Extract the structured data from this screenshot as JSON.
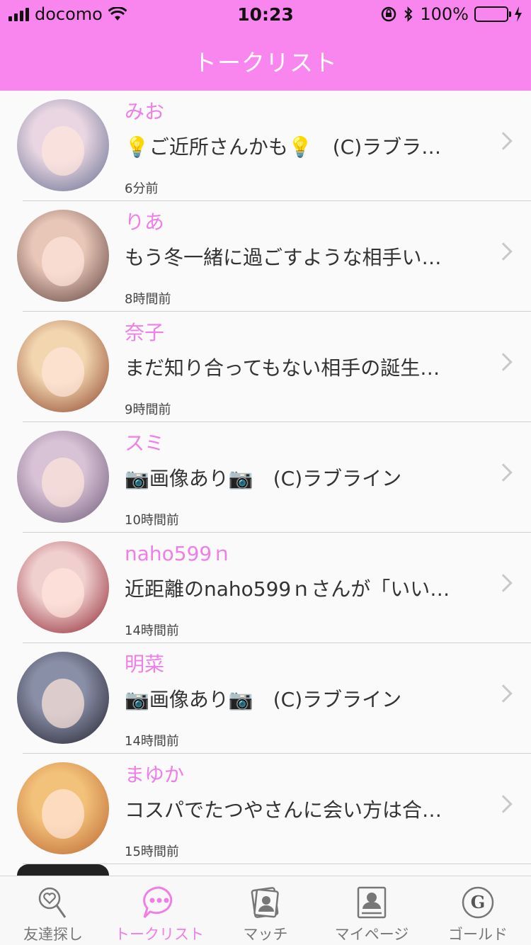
{
  "status_bar": {
    "carrier": "docomo",
    "time": "10:23",
    "battery": "100%"
  },
  "header": {
    "title": "トークリスト"
  },
  "talks": [
    {
      "name": "みお",
      "message": "💡ご近所さんかも💡　(C)ラブラ…",
      "time_ago": "6分前",
      "avatar_colors": [
        "#e9d6e2",
        "#5f6a8c"
      ]
    },
    {
      "name": "りあ",
      "message": "もう冬一緒に過ごすような相手い…",
      "time_ago": "8時間前",
      "avatar_colors": [
        "#e8c7b8",
        "#5b3d3a"
      ]
    },
    {
      "name": "奈子",
      "message": "まだ知り合ってもない相手の誕生…",
      "time_ago": "9時間前",
      "avatar_colors": [
        "#f2d6b0",
        "#8a3e28"
      ]
    },
    {
      "name": "スミ",
      "message": "📷画像あり📷　(C)ラブライン",
      "time_ago": "10時間前",
      "avatar_colors": [
        "#d8c2d6",
        "#6b5876"
      ]
    },
    {
      "name": "naho599ｎ",
      "message": "近距離のnaho599ｎさんが「いい…",
      "time_ago": "14時間前",
      "avatar_colors": [
        "#f0cfcf",
        "#8b1f2a"
      ]
    },
    {
      "name": "明菜",
      "message": "📷画像あり📷　(C)ラブライン",
      "time_ago": "14時間前",
      "avatar_colors": [
        "#8a8fa8",
        "#1e1e28"
      ]
    },
    {
      "name": "まゆか",
      "message": "コスパでたつやさんに会い方は合…",
      "time_ago": "15時間前",
      "avatar_colors": [
        "#f3c27a",
        "#b8622f"
      ]
    }
  ],
  "tabbar": {
    "items": [
      {
        "label": "友達探し",
        "icon": "search-heart-icon",
        "active": false
      },
      {
        "label": "トークリスト",
        "icon": "chat-bubble-icon",
        "active": true
      },
      {
        "label": "マッチ",
        "icon": "match-cards-icon",
        "active": false
      },
      {
        "label": "マイページ",
        "icon": "profile-card-icon",
        "active": false
      },
      {
        "label": "ゴールド",
        "icon": "gold-coin-icon",
        "active": false
      }
    ]
  },
  "colors": {
    "header_bg": "#f986ee",
    "accent": "#ef7ee6",
    "battery": "#4cd964"
  }
}
